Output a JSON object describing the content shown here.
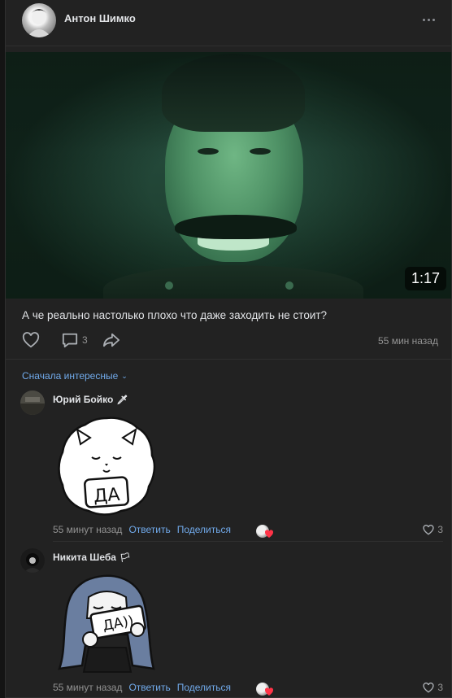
{
  "post": {
    "author": "Антон Шимко",
    "video_duration": "1:17",
    "text": "А че реально настолько плохо что даже заходить не стоит?",
    "comment_count": "3",
    "time": "55 мин назад"
  },
  "comments_sort": "Сначала интересные",
  "comments": [
    {
      "author": "Юрий Бойко",
      "badge": "🗡",
      "sticker_text": "ДА",
      "time": "55 минут назад",
      "reply_label": "Ответить",
      "share_label": "Поделиться",
      "likes": "3"
    },
    {
      "author": "Никита Шеба",
      "badge": "🏳",
      "sticker_text": "ДА))",
      "time": "55 минут назад",
      "reply_label": "Ответить",
      "share_label": "Поделиться",
      "likes": "3"
    }
  ],
  "colors": {
    "background": "#141414",
    "card": "#222222",
    "link": "#71aaeb",
    "muted": "#939393",
    "text": "#e1e3e6"
  }
}
